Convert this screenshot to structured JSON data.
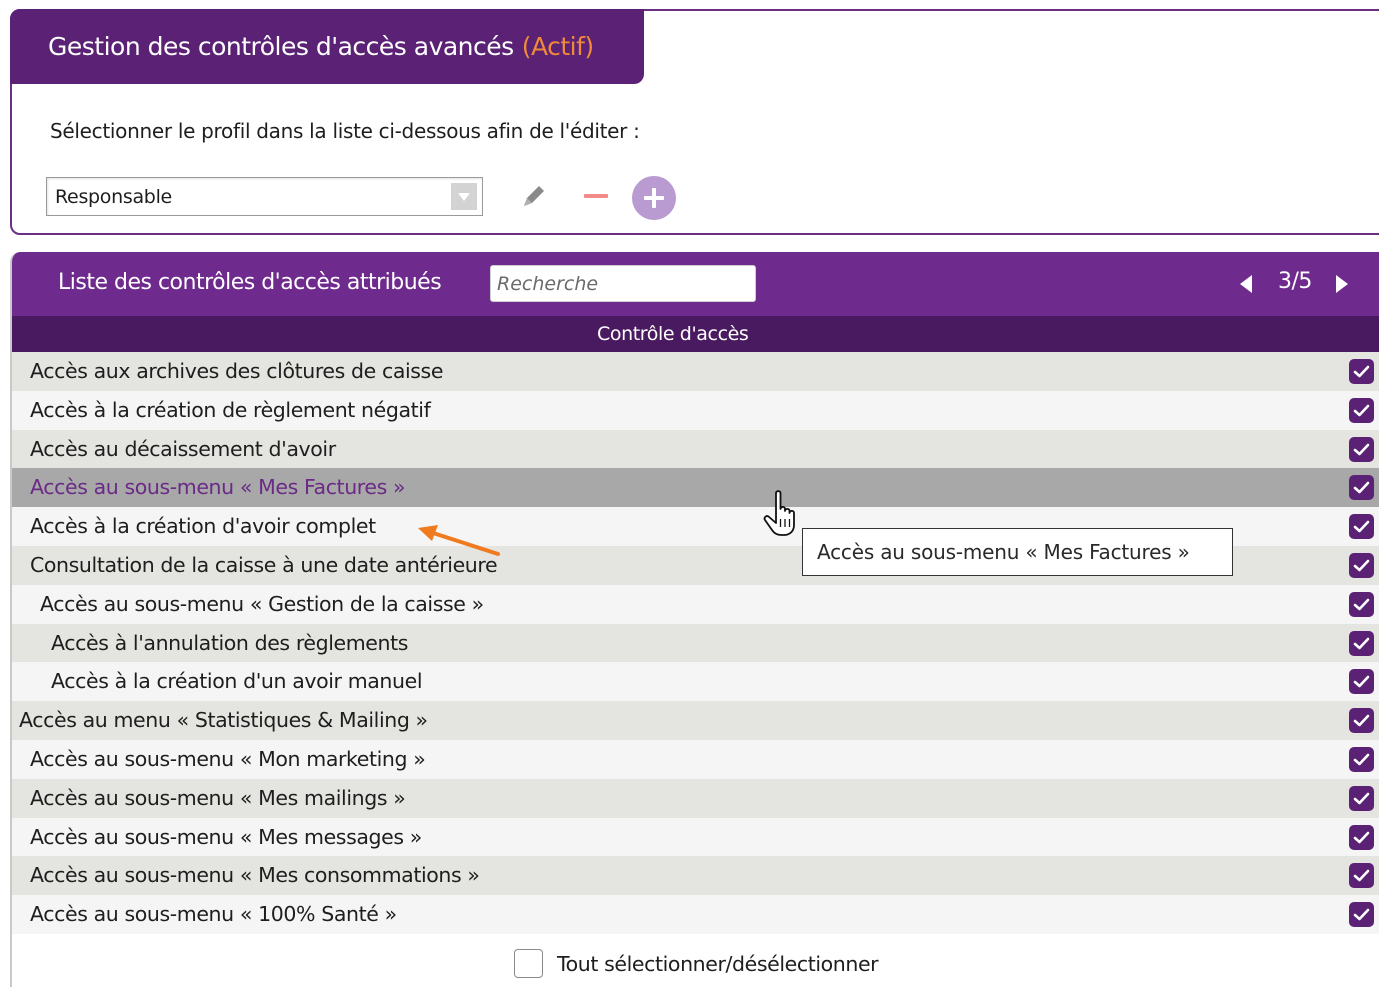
{
  "profile_panel": {
    "title": "Gestion des contrôles d'accès avancés",
    "status": "(Actif)",
    "instruction": "Sélectionner le profil dans la liste ci-dessous afin de l'éditer :",
    "selected_profile": "Responsable"
  },
  "list_panel": {
    "title": "Liste des contrôles d'accès attribués",
    "search_placeholder": "Recherche",
    "pagination": "3/5",
    "column_header": "Contrôle d'accès",
    "rows": [
      {
        "label": "Accès aux archives des clôtures de caisse",
        "checked": true
      },
      {
        "label": "Accès à la création de règlement négatif",
        "checked": true
      },
      {
        "label": "Accès au décaissement d'avoir",
        "checked": true
      },
      {
        "label": "Accès au sous-menu « Mes Factures »",
        "checked": true
      },
      {
        "label": "Accès à la création d'avoir complet",
        "checked": true
      },
      {
        "label": "Consultation de la caisse à une date antérieure",
        "checked": true
      },
      {
        "label": "Accès au sous-menu « Gestion de la caisse »",
        "checked": true
      },
      {
        "label": "Accès à l'annulation des règlements",
        "checked": true
      },
      {
        "label": "Accès à la création d'un avoir manuel",
        "checked": true
      },
      {
        "label": "Accès au menu « Statistiques & Mailing »",
        "checked": true
      },
      {
        "label": "Accès au sous-menu « Mon marketing »",
        "checked": true
      },
      {
        "label": "Accès au sous-menu « Mes mailings »",
        "checked": true
      },
      {
        "label": "Accès au sous-menu « Mes messages »",
        "checked": true
      },
      {
        "label": "Accès au sous-menu « Mes consommations »",
        "checked": true
      },
      {
        "label": "Accès au sous-menu « 100% Santé »",
        "checked": true
      }
    ],
    "select_all_label": "Tout sélectionner/désélectionner",
    "select_all_checked": false
  },
  "tooltip": {
    "text": "Accès au sous-menu « Mes Factures »"
  },
  "icons": {
    "edit": "pencil-icon",
    "remove": "minus-icon",
    "add": "plus-circle-icon",
    "prev": "triangle-left-icon",
    "next": "triangle-right-icon",
    "dropdown": "chevron-down-icon",
    "checkbox": "checkmark-icon",
    "cursor": "hand-pointer-icon",
    "annotation": "orange-arrow-icon"
  },
  "colors": {
    "header_purple": "#6f2a8d",
    "title_purple": "#5a2174",
    "column_header": "#4a1a60",
    "status_orange": "#f08a3a",
    "checkbox_purple": "#5a2174",
    "row_light": "#f5f5f5",
    "row_dark": "#e4e5e0",
    "row_hover": "#a8a8a8",
    "remove_red": "#f28a8a",
    "add_lilac": "#b99ad1",
    "annotation_orange": "#f07a1e"
  }
}
